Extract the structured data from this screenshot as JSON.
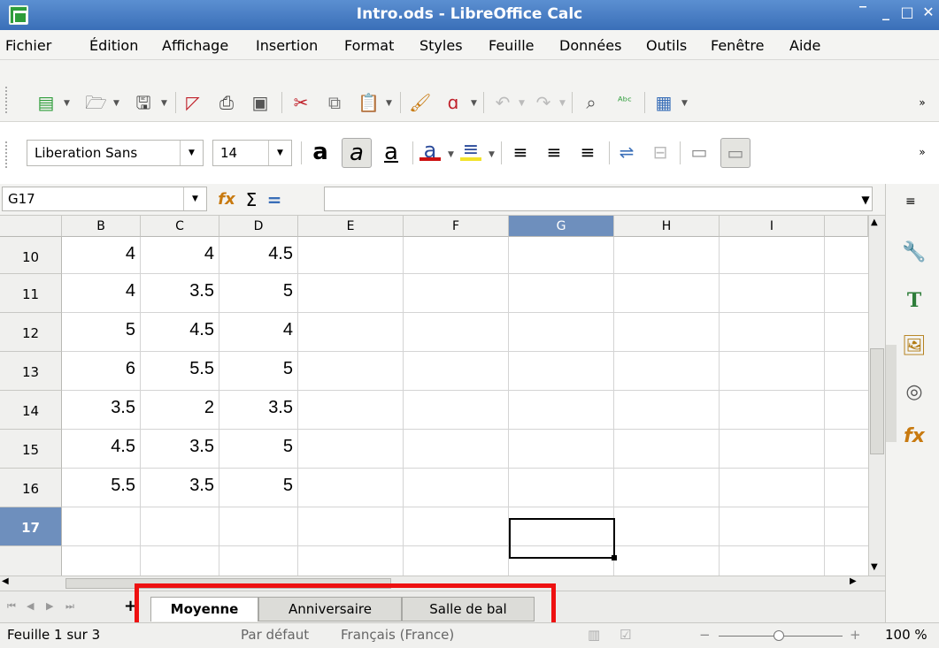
{
  "window": {
    "title": "Intro.ods - LibreOffice Calc"
  },
  "menu": [
    "Fichier",
    "Édition",
    "Affichage",
    "Insertion",
    "Format",
    "Styles",
    "Feuille",
    "Données",
    "Outils",
    "Fenêtre",
    "Aide"
  ],
  "formatting": {
    "font_name": "Liberation Sans",
    "font_size": "14"
  },
  "formula_bar": {
    "cell_ref": "G17",
    "sum_symbol": "Σ",
    "equals_symbol": "=",
    "formula": ""
  },
  "columns": [
    "B",
    "C",
    "D",
    "E",
    "F",
    "G",
    "H",
    "I"
  ],
  "selected_column": "G",
  "rows": [
    {
      "num": "10",
      "cells": [
        "4",
        "4",
        "4.5"
      ]
    },
    {
      "num": "11",
      "cells": [
        "4",
        "3.5",
        "5"
      ]
    },
    {
      "num": "12",
      "cells": [
        "5",
        "4.5",
        "4"
      ]
    },
    {
      "num": "13",
      "cells": [
        "6",
        "5.5",
        "5"
      ]
    },
    {
      "num": "14",
      "cells": [
        "3.5",
        "2",
        "3.5"
      ]
    },
    {
      "num": "15",
      "cells": [
        "4.5",
        "3.5",
        "5"
      ]
    },
    {
      "num": "16",
      "cells": [
        "5.5",
        "3.5",
        "5"
      ]
    },
    {
      "num": "17",
      "cells": [
        "",
        "",
        ""
      ]
    }
  ],
  "selected_row": "17",
  "sheet_tabs": [
    {
      "label": "Moyenne",
      "active": true
    },
    {
      "label": "Anniversaire",
      "active": false
    },
    {
      "label": "Salle de bal",
      "active": false
    }
  ],
  "add_sheet_label": "+",
  "status": {
    "sheet": "Feuille 1 sur 3",
    "page_style": "Par défaut",
    "language": "Français (France)",
    "zoom": "100 %",
    "zoom_minus": "−",
    "zoom_plus": "+"
  },
  "colors": {
    "title_bar": "#3a6fb8",
    "selection_header": "#6e8fbd",
    "highlight_box": "#ee1111"
  }
}
